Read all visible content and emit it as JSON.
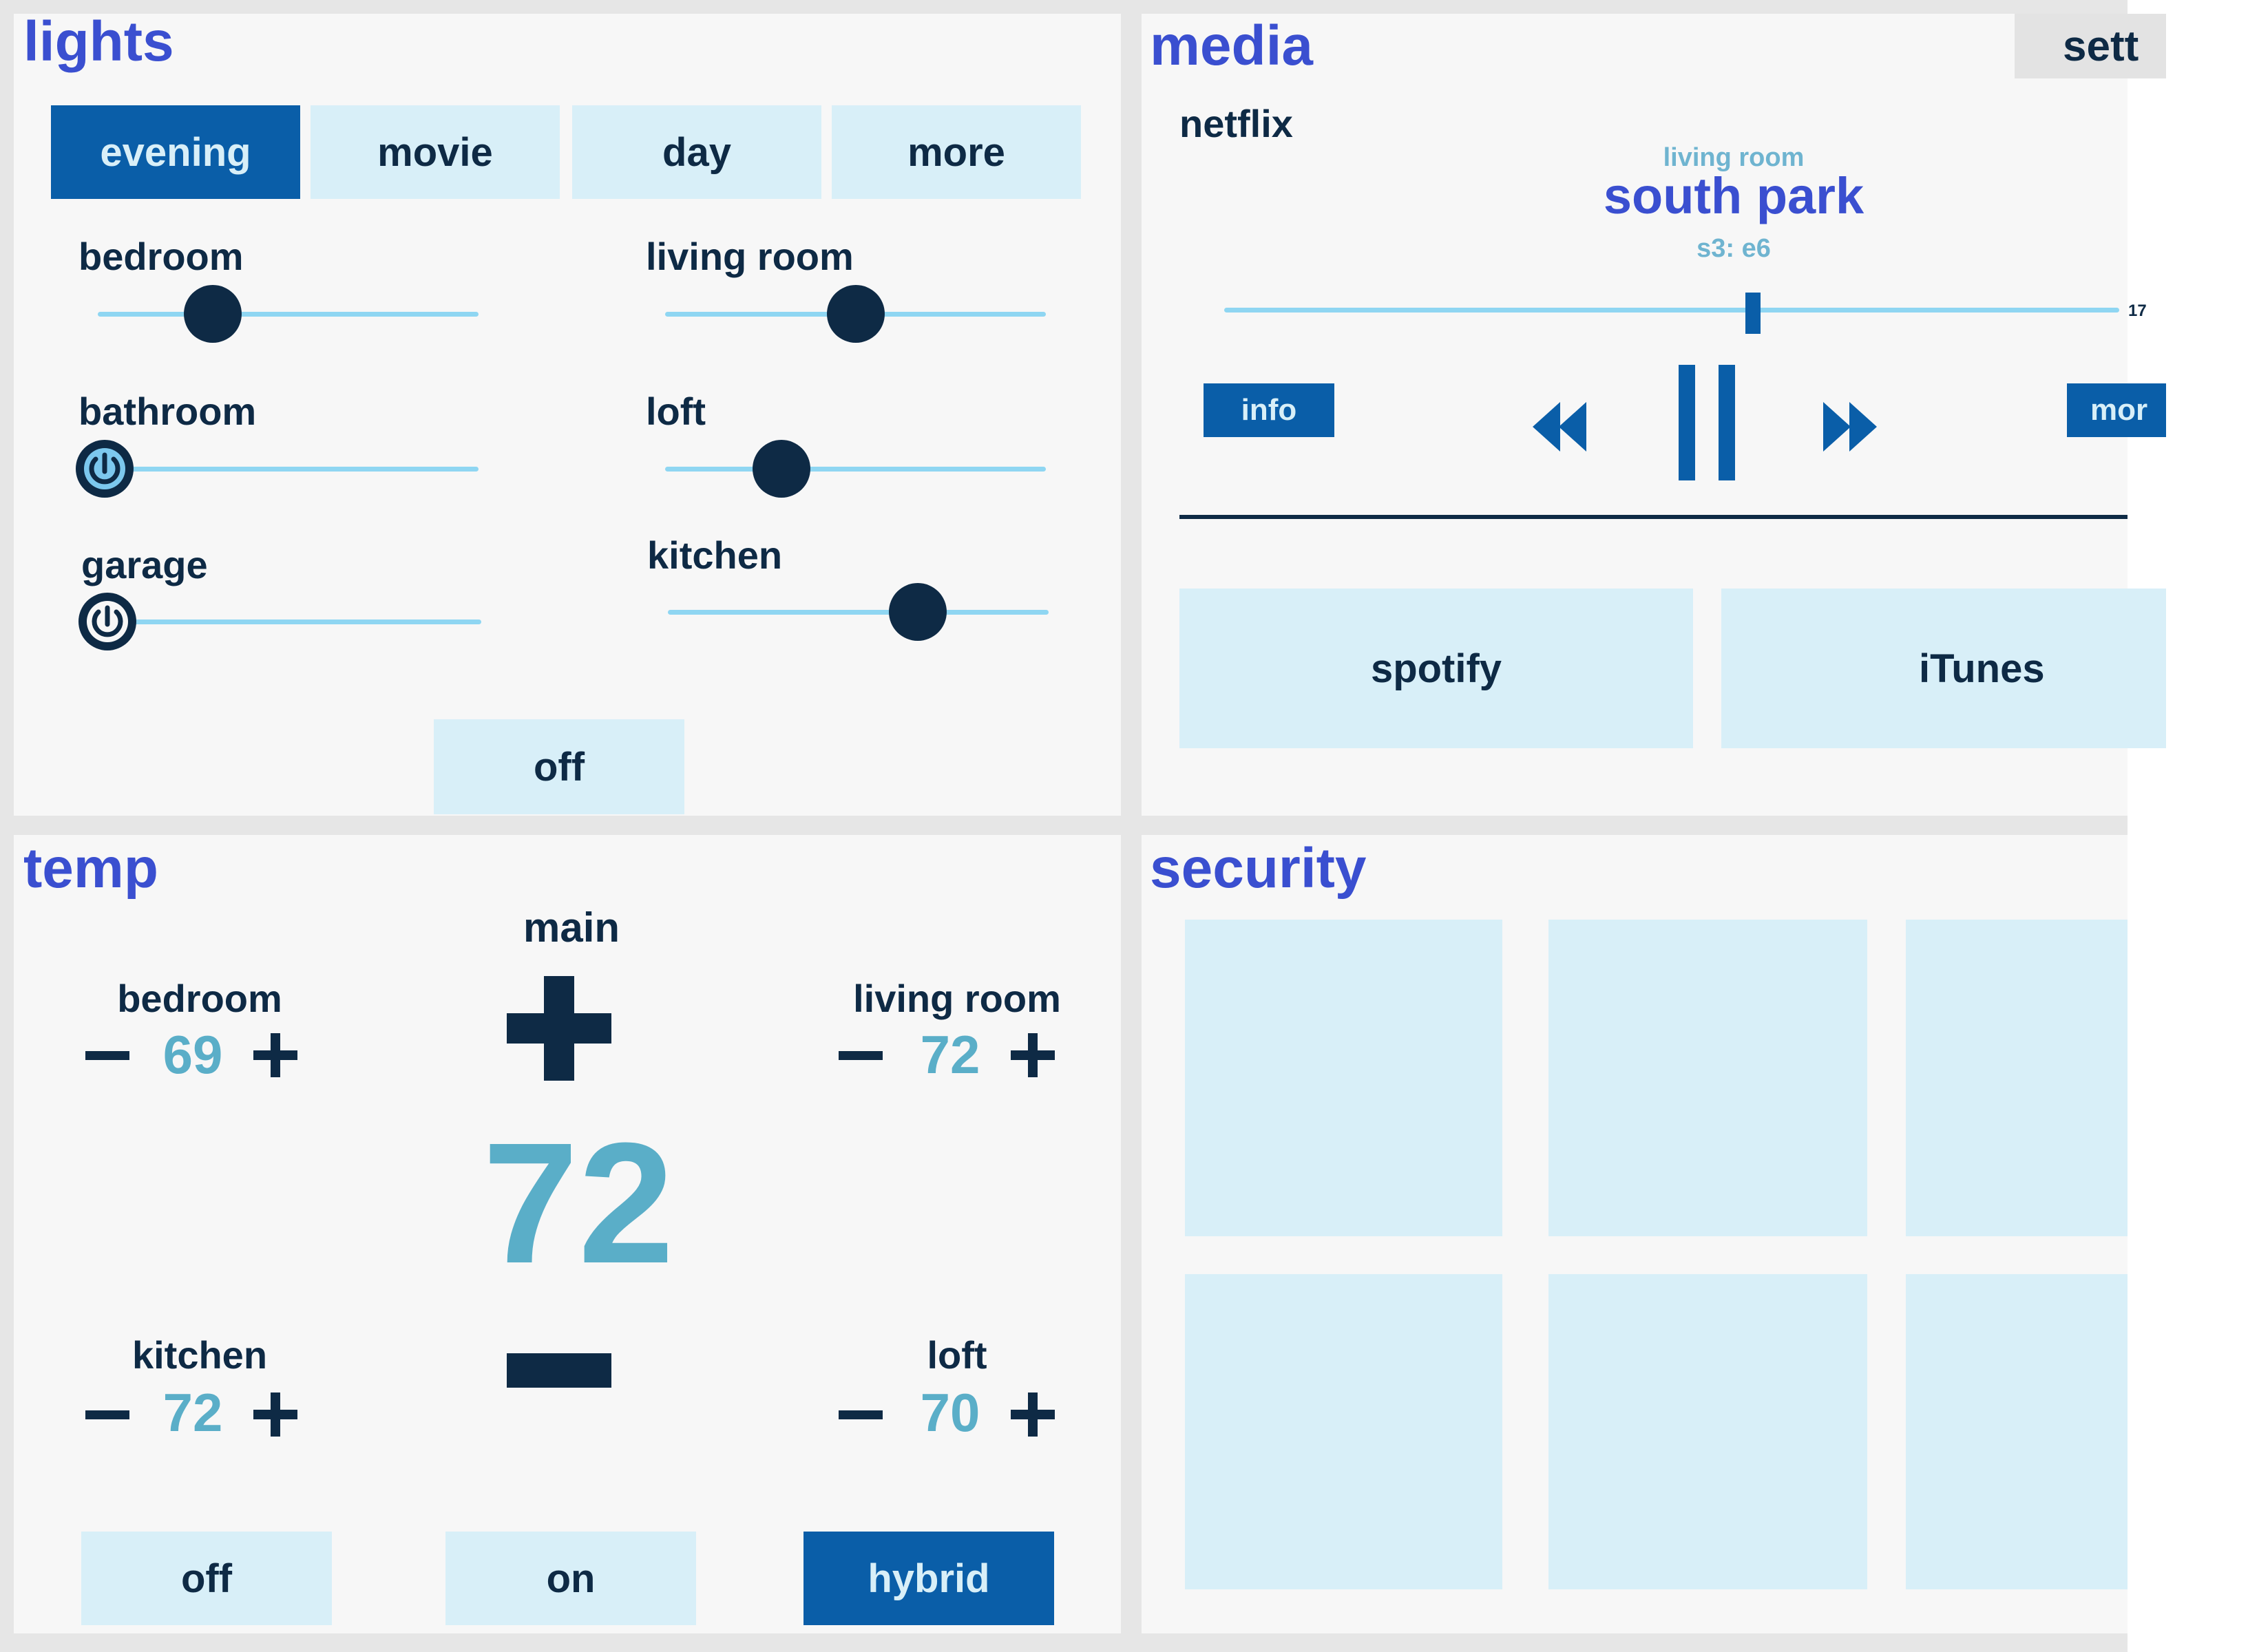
{
  "lights": {
    "title": "lights",
    "scenes": [
      "evening",
      "movie",
      "day",
      "more"
    ],
    "active_scene": "evening",
    "rooms": [
      {
        "name": "bedroom",
        "level": 0.3,
        "on": true
      },
      {
        "name": "living room",
        "level": 0.5,
        "on": true
      },
      {
        "name": "bathroom",
        "level": 0.0,
        "on": false
      },
      {
        "name": "loft",
        "level": 0.3,
        "on": true
      },
      {
        "name": "garage",
        "level": 0.0,
        "on": false
      },
      {
        "name": "kitchen",
        "level": 0.65,
        "on": true
      }
    ],
    "off_label": "off"
  },
  "media": {
    "title": "media",
    "settings_tab": "sett",
    "source": "netflix",
    "room": "living room",
    "show": "south park",
    "episode": "s3: e6",
    "progress": 0.6,
    "time_label": "17",
    "info_label": "info",
    "more_label": "mor",
    "sources": [
      "spotify",
      "iTunes"
    ]
  },
  "temp": {
    "title": "temp",
    "main_label": "main",
    "main_value": "72",
    "zones": [
      {
        "name": "bedroom",
        "value": "69"
      },
      {
        "name": "living room",
        "value": "72"
      },
      {
        "name": "kitchen",
        "value": "72"
      },
      {
        "name": "loft",
        "value": "70"
      }
    ],
    "modes": [
      "off",
      "on",
      "hybrid"
    ],
    "active_mode": "hybrid"
  },
  "security": {
    "title": "security"
  },
  "colors": {
    "title": "#3a4fd0",
    "accent": "#0a5ea8",
    "tile": "#d8eff8",
    "dark": "#0e2a45",
    "value": "#5aaec8",
    "track": "#8fd6f2"
  }
}
